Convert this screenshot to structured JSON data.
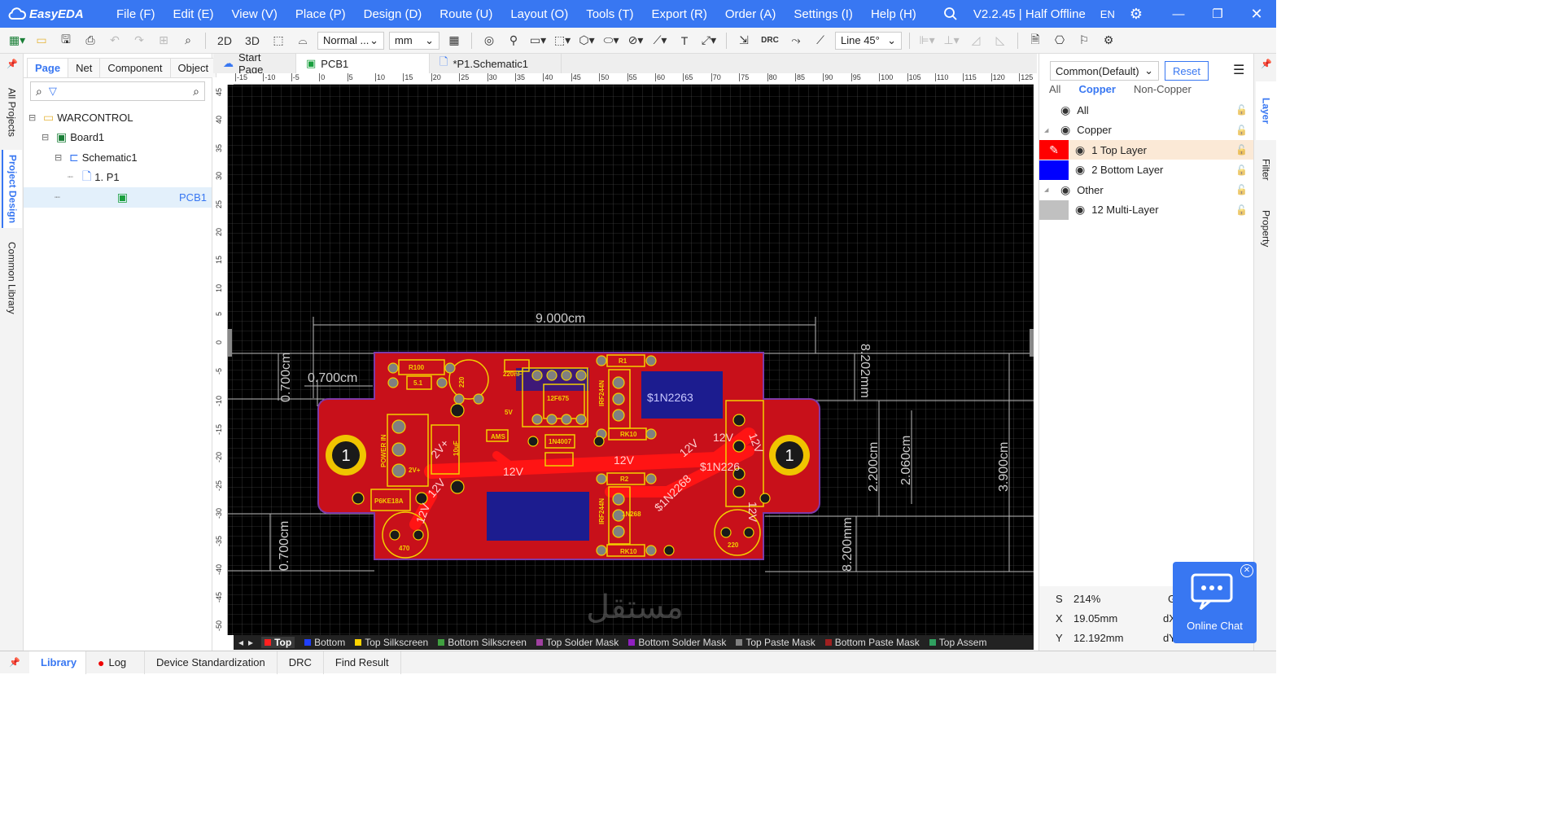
{
  "app": {
    "name": "EasyEDA",
    "version_status": "V2.2.45 | Half Offline",
    "lang": "EN"
  },
  "menus": [
    "File (F)",
    "Edit (E)",
    "View (V)",
    "Place (P)",
    "Design (D)",
    "Route (U)",
    "Layout (O)",
    "Tools (T)",
    "Export (R)",
    "Order (A)",
    "Settings (I)",
    "Help (H)"
  ],
  "toolbar": {
    "view_2d": "2D",
    "view_3d": "3D",
    "mode": "Normal ...",
    "unit": "mm",
    "drc": "DRC",
    "routing_angle": "Line 45°"
  },
  "left_strip": {
    "all_projects": "All Projects",
    "project_design": "Project Design",
    "common_library": "Common Library"
  },
  "left_panel": {
    "tabs": [
      "Page",
      "Net",
      "Component",
      "Object"
    ],
    "tree": [
      {
        "label": "WARCONTROL",
        "level": 0,
        "icon": "folder-icon"
      },
      {
        "label": "Board1",
        "level": 1,
        "icon": "board-icon"
      },
      {
        "label": "Schematic1",
        "level": 2,
        "icon": "schematic-icon"
      },
      {
        "label": "1. P1",
        "level": 3,
        "icon": "page-icon"
      },
      {
        "label": "PCB1",
        "level": 2,
        "icon": "pcb-icon"
      }
    ]
  },
  "doc_tabs": [
    "Start Page",
    "PCB1",
    "*P1.Schematic1"
  ],
  "ruler": {
    "h": [
      "-15",
      "-10",
      "-5",
      "0",
      "5",
      "10",
      "15",
      "20",
      "25",
      "30",
      "35",
      "40",
      "45",
      "50",
      "55",
      "60",
      "65",
      "70",
      "75",
      "80",
      "85",
      "90",
      "95",
      "100",
      "105",
      "110",
      "115",
      "120",
      "125"
    ],
    "v": [
      "45",
      "40",
      "35",
      "30",
      "25",
      "20",
      "15",
      "10",
      "5",
      "0",
      "-5",
      "-10",
      "-15",
      "-20",
      "-25",
      "-30",
      "-35",
      "-40",
      "-45",
      "-50"
    ]
  },
  "pcb": {
    "dimensions": {
      "width": "9.000cm",
      "ear_width": "0.700cm",
      "ear_height_top": "0.700cm",
      "ear_height_bottom": "0.700cm",
      "right_top": "8.202mm",
      "right_bottom": "8.200mm",
      "inner_a": "2.200cm",
      "inner_b": "2.060cm",
      "height": "3.900cm"
    },
    "labels": {
      "r100": "R100",
      "r51": "5.1",
      "cap220a": "220",
      "cap220nf": "220nF",
      "ic": "12F675",
      "v5": "5V",
      "r1": "R1",
      "irf1": "IRF244N",
      "rk10a": "RK10",
      "net1": "$1N2263",
      "hole1": "1",
      "hole2": "1",
      "power_in": "POWER IN",
      "v12a": "12V",
      "v12b": "12V",
      "v12c": "12V",
      "v12d": "12V",
      "v12e": "12V",
      "v12f": "12V",
      "v12g": "12V",
      "v12h": "12V",
      "v12i": "12V",
      "ams": "AMS",
      "diode": "1N4007",
      "r2": "R2",
      "net2": "$1N2268",
      "net3": "$1N226",
      "p6ke": "P6KE18A",
      "cap470": "470",
      "rk10b": "RK10",
      "cap220b": "220",
      "irf2": "IRF244N",
      "n268": "1N268",
      "v2v": "2V+",
      "v2vb": "2V+",
      "v10": "10uF"
    }
  },
  "layer_bar": [
    {
      "label": "Top",
      "color": "#ff2020",
      "active": true
    },
    {
      "label": "Bottom",
      "color": "#2040ff"
    },
    {
      "label": "Top Silkscreen",
      "color": "#ffd400"
    },
    {
      "label": "Bottom Silkscreen",
      "color": "#40a040"
    },
    {
      "label": "Top Solder Mask",
      "color": "#a040a0"
    },
    {
      "label": "Bottom Solder Mask",
      "color": "#9020c0"
    },
    {
      "label": "Top Paste Mask",
      "color": "#808080"
    },
    {
      "label": "Bottom Paste Mask",
      "color": "#a02020"
    },
    {
      "label": "Top Assem",
      "color": "#30a060"
    }
  ],
  "right_panel": {
    "preset": "Common(Default)",
    "reset": "Reset",
    "filter_tabs": [
      "All",
      "Copper",
      "Non-Copper"
    ],
    "layers": [
      {
        "label": "All",
        "indent": false,
        "color": ""
      },
      {
        "label": "Copper",
        "indent": false,
        "color": "",
        "group": true
      },
      {
        "label": "1 Top Layer",
        "indent": true,
        "color": "#ff0000",
        "active": true
      },
      {
        "label": "2 Bottom Layer",
        "indent": true,
        "color": "#0000ff"
      },
      {
        "label": "Other",
        "indent": false,
        "color": "",
        "group": true
      },
      {
        "label": "12 Multi-Layer",
        "indent": true,
        "color": "#c0c0c0"
      }
    ]
  },
  "status": {
    "scale_label": "S",
    "scale": "214%",
    "x_label": "X",
    "x": "19.05mm",
    "y_label": "Y",
    "y": "12.192mm",
    "g": "G",
    "dx": "dX",
    "dy": "dY"
  },
  "right_strip": {
    "layer": "Layer",
    "filter": "Filter",
    "property": "Property"
  },
  "bottom_tabs": [
    "Library",
    "Log",
    "Device Standardization",
    "DRC",
    "Find Result"
  ],
  "chat": {
    "label": "Online Chat"
  },
  "watermark": "مستقل"
}
